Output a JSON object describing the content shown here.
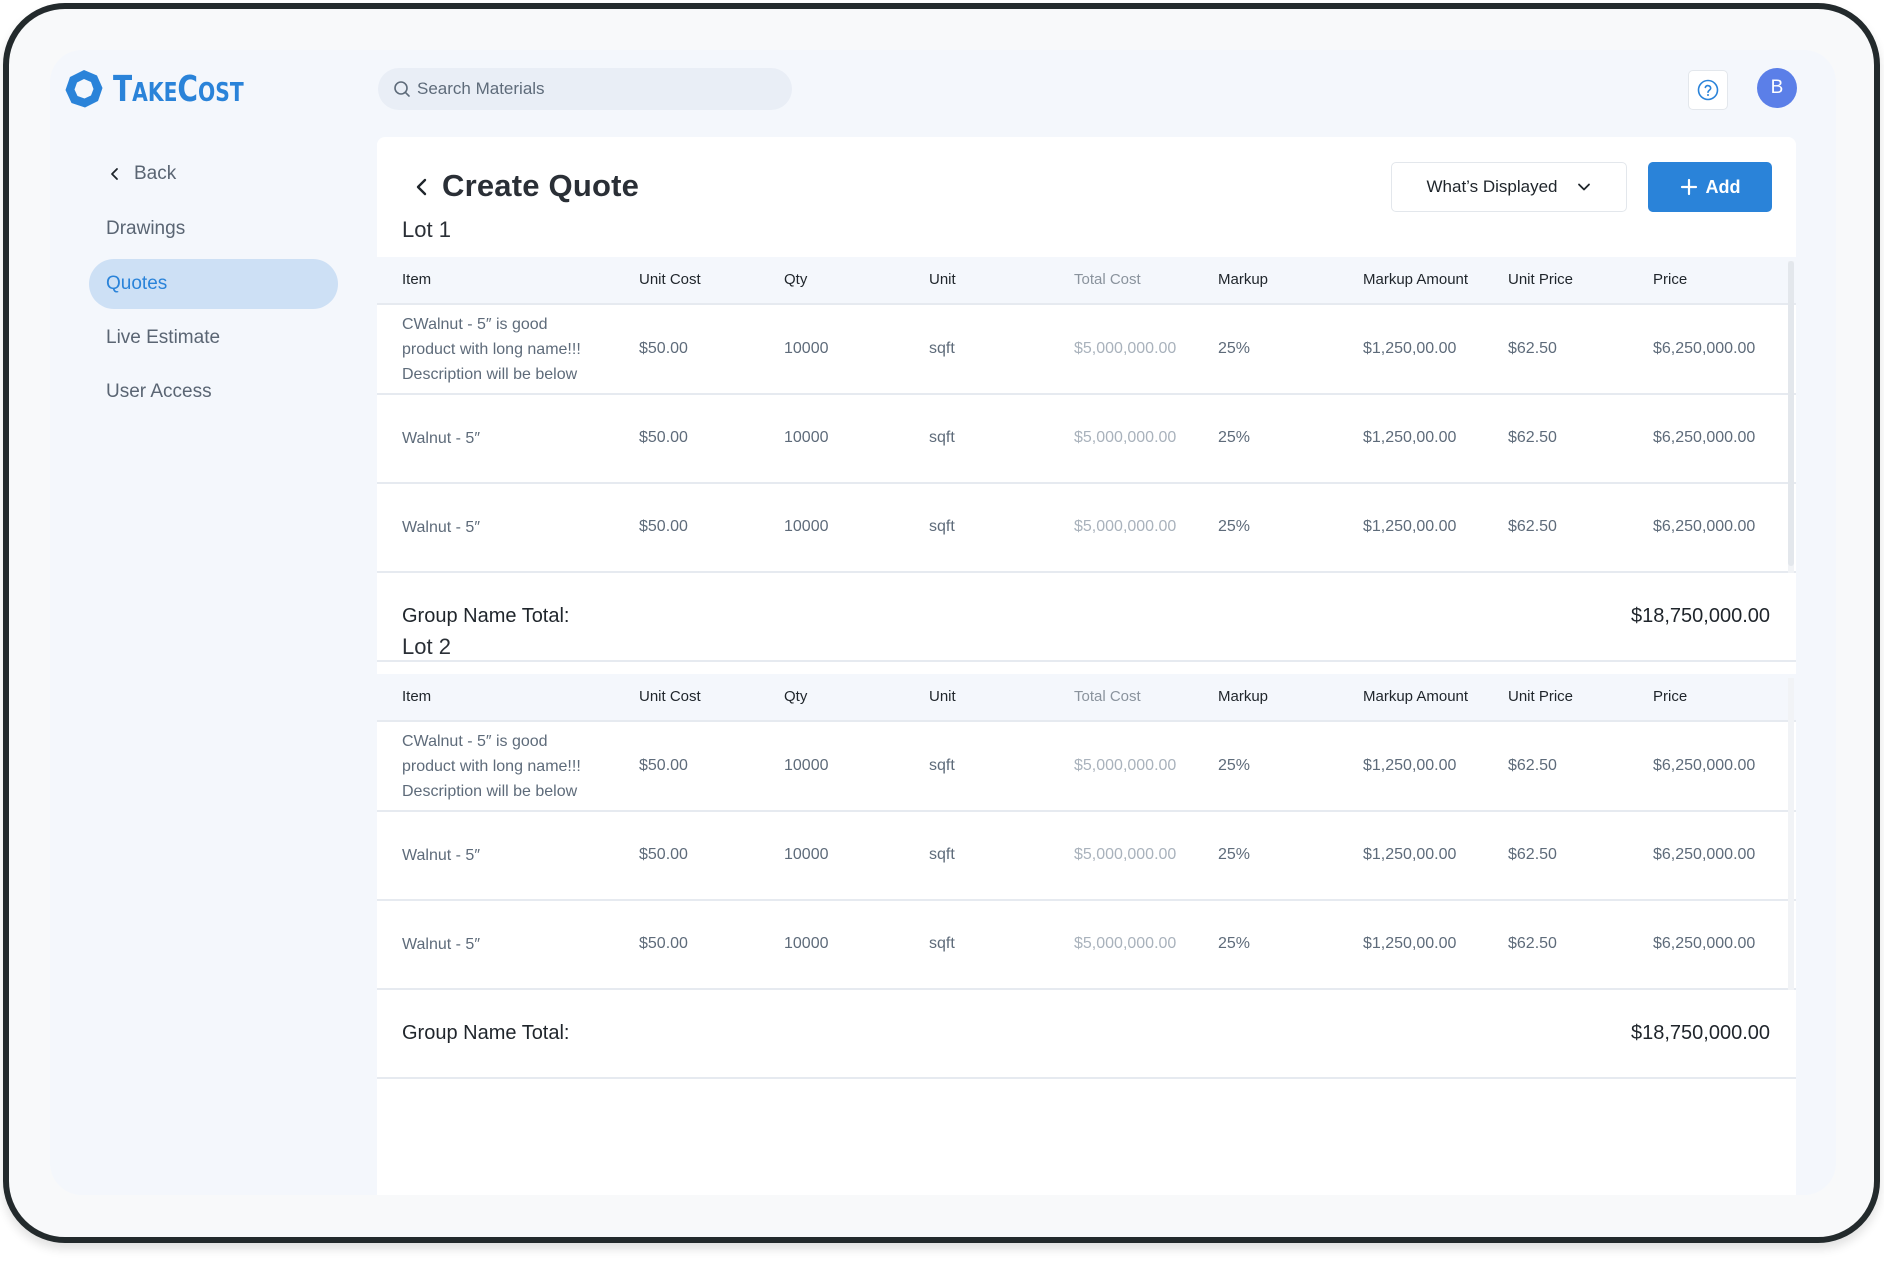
{
  "app": {
    "brand": "TakeCost",
    "brand_parts": [
      "T",
      "AKE",
      "C",
      "OST"
    ],
    "brand_color": "#2a83d9"
  },
  "header": {
    "search_placeholder": "Search Materials",
    "help_icon": "question-circle-icon",
    "avatar_initial": "B",
    "avatar_color": "#5b7fe8"
  },
  "sidebar": {
    "back_label": "Back",
    "items": [
      {
        "label": "Drawings",
        "active": false
      },
      {
        "label": "Quotes",
        "active": true
      },
      {
        "label": "Live Estimate",
        "active": false
      },
      {
        "label": "User Access",
        "active": false
      }
    ]
  },
  "page": {
    "title": "Create Quote",
    "display_button": "What’s Displayed",
    "add_button": "Add"
  },
  "table": {
    "columns": [
      "Item",
      "Unit Cost",
      "Qty",
      "Unit",
      "Total Cost",
      "Markup",
      "Markup Amount",
      "Unit Price",
      "Price"
    ]
  },
  "lots": [
    {
      "label": "Lot 1",
      "rows": [
        {
          "item": "CWalnut - 5″ is good product with long name!!! Description will be below",
          "unit_cost": "$50.00",
          "qty": "10000",
          "unit": "sqft",
          "total_cost": "$5,000,000.00",
          "markup": "25%",
          "markup_amount": "$1,250,00.00",
          "unit_price": "$62.50",
          "price": "$6,250,000.00"
        },
        {
          "item": "Walnut - 5″",
          "unit_cost": "$50.00",
          "qty": "10000",
          "unit": "sqft",
          "total_cost": "$5,000,000.00",
          "markup": "25%",
          "markup_amount": "$1,250,00.00",
          "unit_price": "$62.50",
          "price": "$6,250,000.00"
        },
        {
          "item": "Walnut - 5″",
          "unit_cost": "$50.00",
          "qty": "10000",
          "unit": "sqft",
          "total_cost": "$5,000,000.00",
          "markup": "25%",
          "markup_amount": "$1,250,00.00",
          "unit_price": "$62.50",
          "price": "$6,250,000.00"
        }
      ],
      "total_label": "Group Name Total:",
      "total_value": "$18,750,000.00"
    },
    {
      "label": "Lot 2",
      "rows": [
        {
          "item": "CWalnut - 5″ is good product with long name!!! Description will be below",
          "unit_cost": "$50.00",
          "qty": "10000",
          "unit": "sqft",
          "total_cost": "$5,000,000.00",
          "markup": "25%",
          "markup_amount": "$1,250,00.00",
          "unit_price": "$62.50",
          "price": "$6,250,000.00"
        },
        {
          "item": "Walnut - 5″",
          "unit_cost": "$50.00",
          "qty": "10000",
          "unit": "sqft",
          "total_cost": "$5,000,000.00",
          "markup": "25%",
          "markup_amount": "$1,250,00.00",
          "unit_price": "$62.50",
          "price": "$6,250,000.00"
        },
        {
          "item": "Walnut - 5″",
          "unit_cost": "$50.00",
          "qty": "10000",
          "unit": "sqft",
          "total_cost": "$5,000,000.00",
          "markup": "25%",
          "markup_amount": "$1,250,00.00",
          "unit_price": "$62.50",
          "price": "$6,250,000.00"
        }
      ],
      "total_label": "Group Name Total:",
      "total_value": "$18,750,000.00"
    }
  ]
}
